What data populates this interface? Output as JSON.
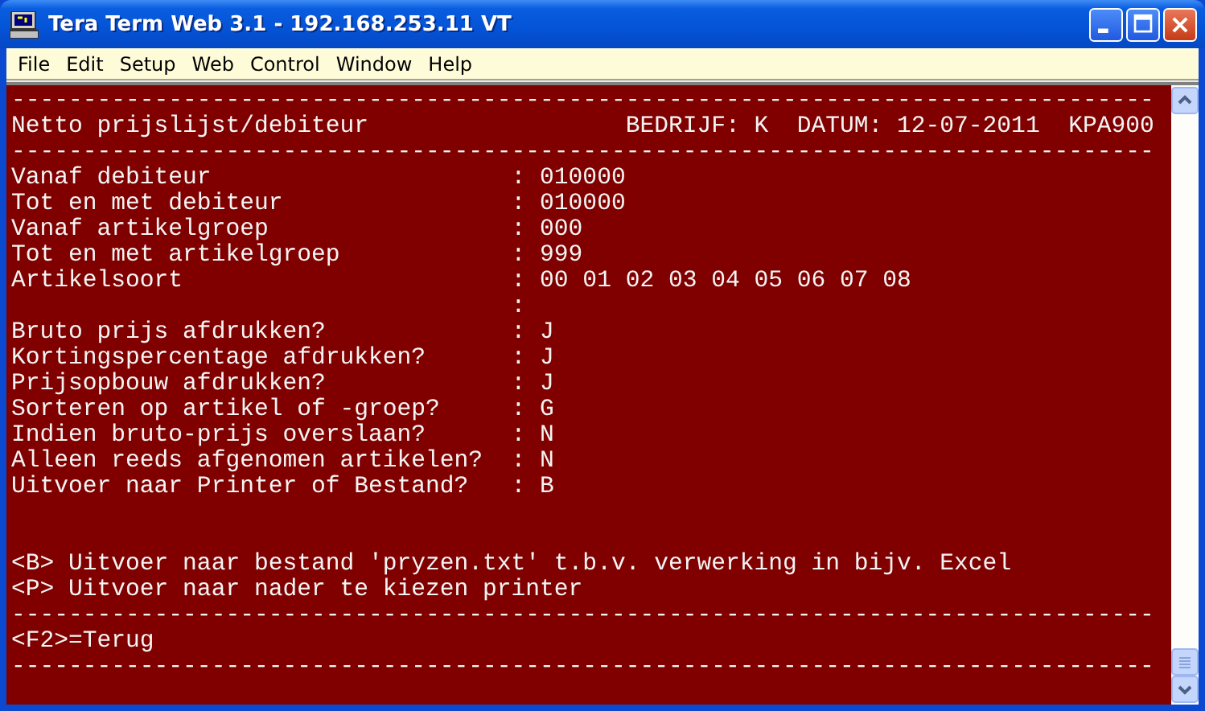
{
  "window": {
    "title": "Tera Term Web 3.1 - 192.168.253.11 VT"
  },
  "menu": [
    "File",
    "Edit",
    "Setup",
    "Web",
    "Control",
    "Window",
    "Help"
  ],
  "terminal": {
    "lines": [
      {
        "kind": "rule",
        "text": "--------------------------------------------------------------------------------"
      },
      {
        "kind": "header",
        "title": "Netto prijslijst/debiteur",
        "info": "BEDRIJF: K  DATUM: 12-07-2011  KPA900"
      },
      {
        "kind": "rule",
        "text": "--------------------------------------------------------------------------------"
      },
      {
        "kind": "field",
        "label": "Vanaf debiteur",
        "sep": ":",
        "value": "010000"
      },
      {
        "kind": "field",
        "label": "Tot en met debiteur",
        "sep": ":",
        "value": "010000"
      },
      {
        "kind": "field",
        "label": "Vanaf artikelgroep",
        "sep": ":",
        "value": "000"
      },
      {
        "kind": "field",
        "label": "Tot en met artikelgroep",
        "sep": ":",
        "value": "999"
      },
      {
        "kind": "field",
        "label": "Artikelsoort",
        "sep": ":",
        "value": "00 01 02 03 04 05 06 07 08"
      },
      {
        "kind": "field",
        "sep": ":"
      },
      {
        "kind": "field",
        "label": "Bruto prijs afdrukken?",
        "sep": ":",
        "value": "J"
      },
      {
        "kind": "field",
        "label": "Kortingspercentage afdrukken?",
        "sep": ":",
        "value": "J"
      },
      {
        "kind": "field",
        "label": "Prijsopbouw afdrukken?",
        "sep": ":",
        "value": "J"
      },
      {
        "kind": "field",
        "label": "Sorteren op artikel of -groep?",
        "sep": ":",
        "value": "G"
      },
      {
        "kind": "field",
        "label": "Indien bruto-prijs overslaan?",
        "sep": ":",
        "value": "N"
      },
      {
        "kind": "field",
        "label": "Alleen reeds afgenomen artikelen?",
        "sep": ":",
        "value": "N"
      },
      {
        "kind": "field",
        "label": "Uitvoer naar Printer of Bestand?",
        "sep": ":",
        "value": "B"
      },
      {
        "kind": "blank"
      },
      {
        "kind": "blank"
      },
      {
        "kind": "text",
        "text": "<B> Uitvoer naar bestand 'pryzen.txt' t.b.v. verwerking in bijv. Excel"
      },
      {
        "kind": "text",
        "text": "<P> Uitvoer naar nader te kiezen printer"
      },
      {
        "kind": "rule",
        "text": "--------------------------------------------------------------------------------"
      },
      {
        "kind": "text",
        "text": "<F2>=Terug"
      },
      {
        "kind": "rule",
        "text": "--------------------------------------------------------------------------------"
      }
    ]
  }
}
